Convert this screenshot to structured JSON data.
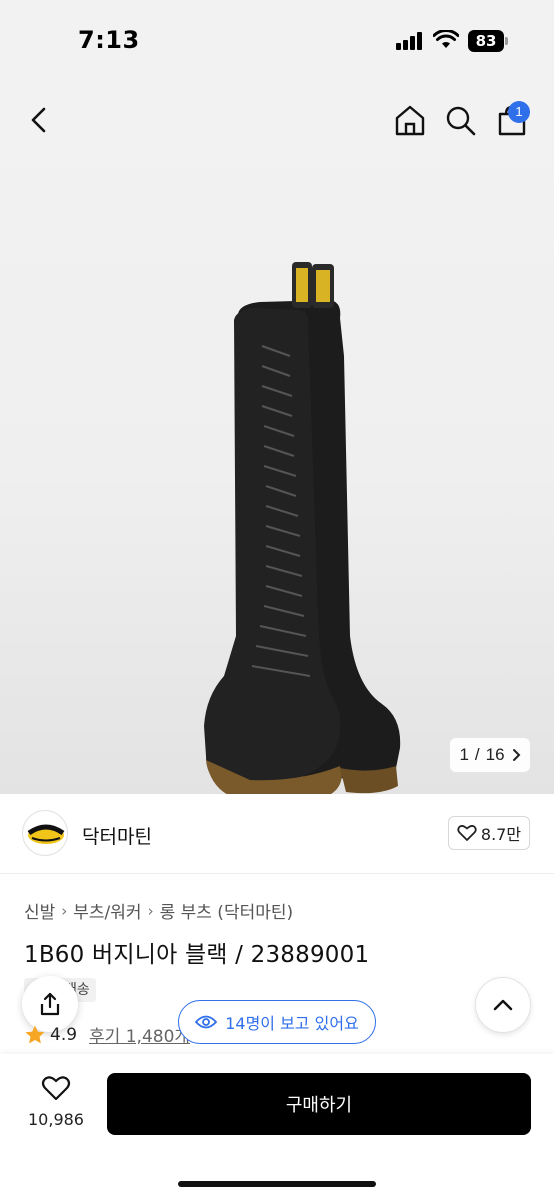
{
  "status_bar": {
    "time": "7:13",
    "battery": "83"
  },
  "nav": {
    "cart_count": "1"
  },
  "gallery": {
    "current": "1",
    "separator": "/",
    "total": "16"
  },
  "brand": {
    "name": "닥터마틴",
    "likes": "8.7만"
  },
  "breadcrumb": [
    "신발",
    "부츠/워커",
    "롱 부츠 (닥터마틴)"
  ],
  "product": {
    "title": "1B60 버지니아 블랙 / 23889001",
    "tag": "배송",
    "rating": "4.9",
    "reviews": "후기 1,480개",
    "viewers": "14명이 보고 있어요"
  },
  "bottom": {
    "wish_count": "10,986",
    "buy_label": "구매하기"
  },
  "colors": {
    "accent": "#2f6fea",
    "primary_button": "#000000",
    "star": "#f5a623"
  },
  "icons": [
    "back-icon",
    "home-icon",
    "search-icon",
    "cart-icon",
    "chevron-right-icon",
    "heart-icon",
    "share-icon",
    "eye-icon",
    "chevron-up-icon",
    "star-icon"
  ]
}
